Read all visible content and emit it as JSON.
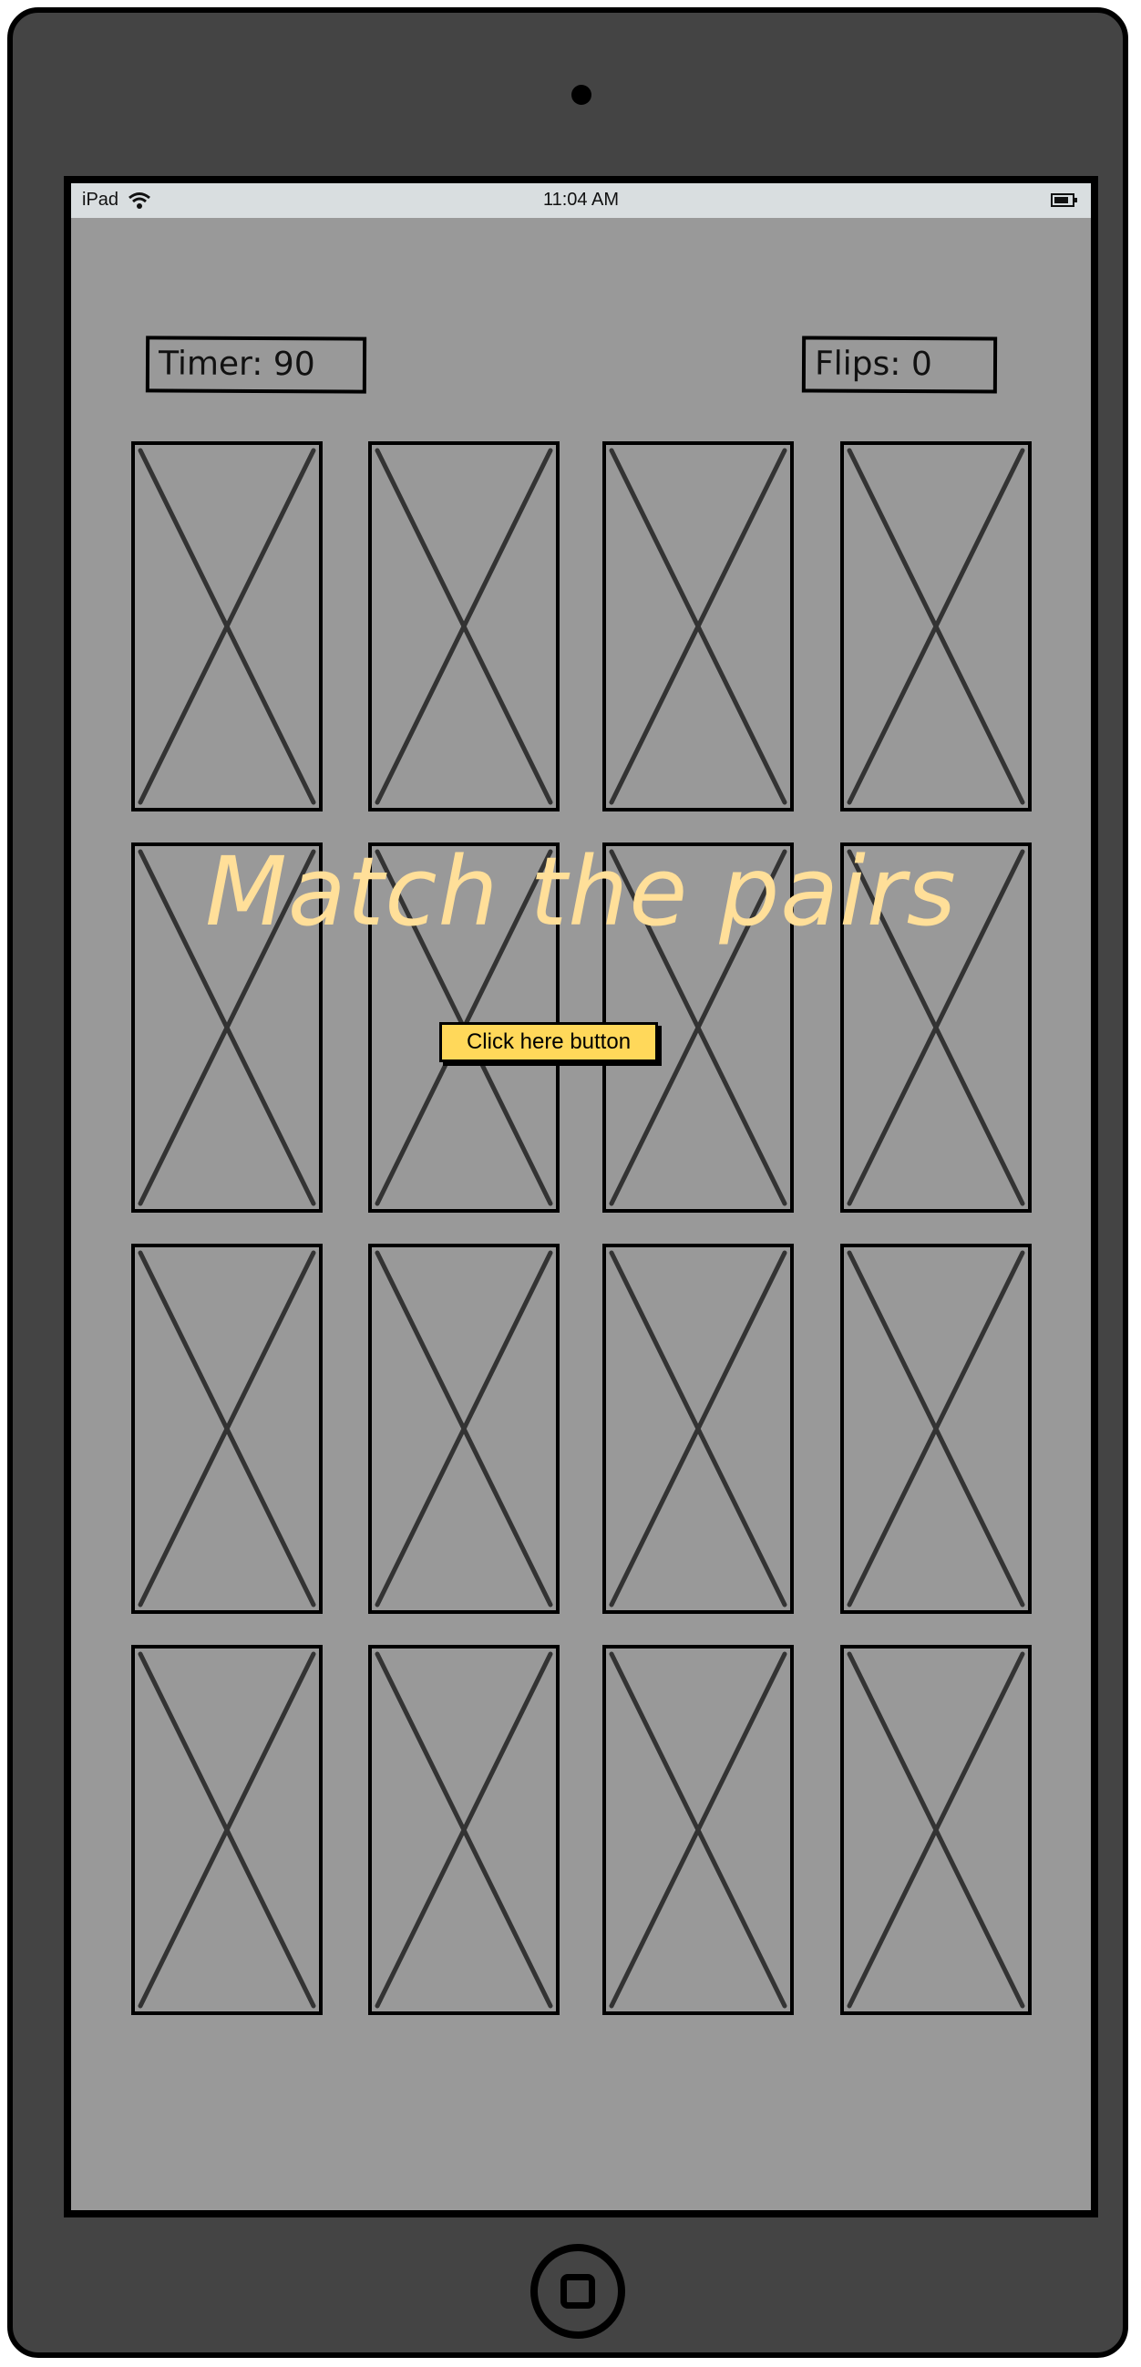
{
  "status_bar": {
    "device": "iPad",
    "time": "11:04 AM",
    "icons": [
      "wifi-icon",
      "battery-icon"
    ]
  },
  "game": {
    "timer_label": "Timer: 90",
    "flips_label": "Flips: 0",
    "title": "Match the pairs",
    "start_button": "Click here button",
    "card_count": 16,
    "card_icon": "image-placeholder-icon"
  },
  "colors": {
    "device": "#444444",
    "screen": "#999999",
    "status_bar": "#d9dee0",
    "title": "#ffdf99",
    "button": "#ffd85a",
    "placeholder_stroke": "#333333"
  }
}
